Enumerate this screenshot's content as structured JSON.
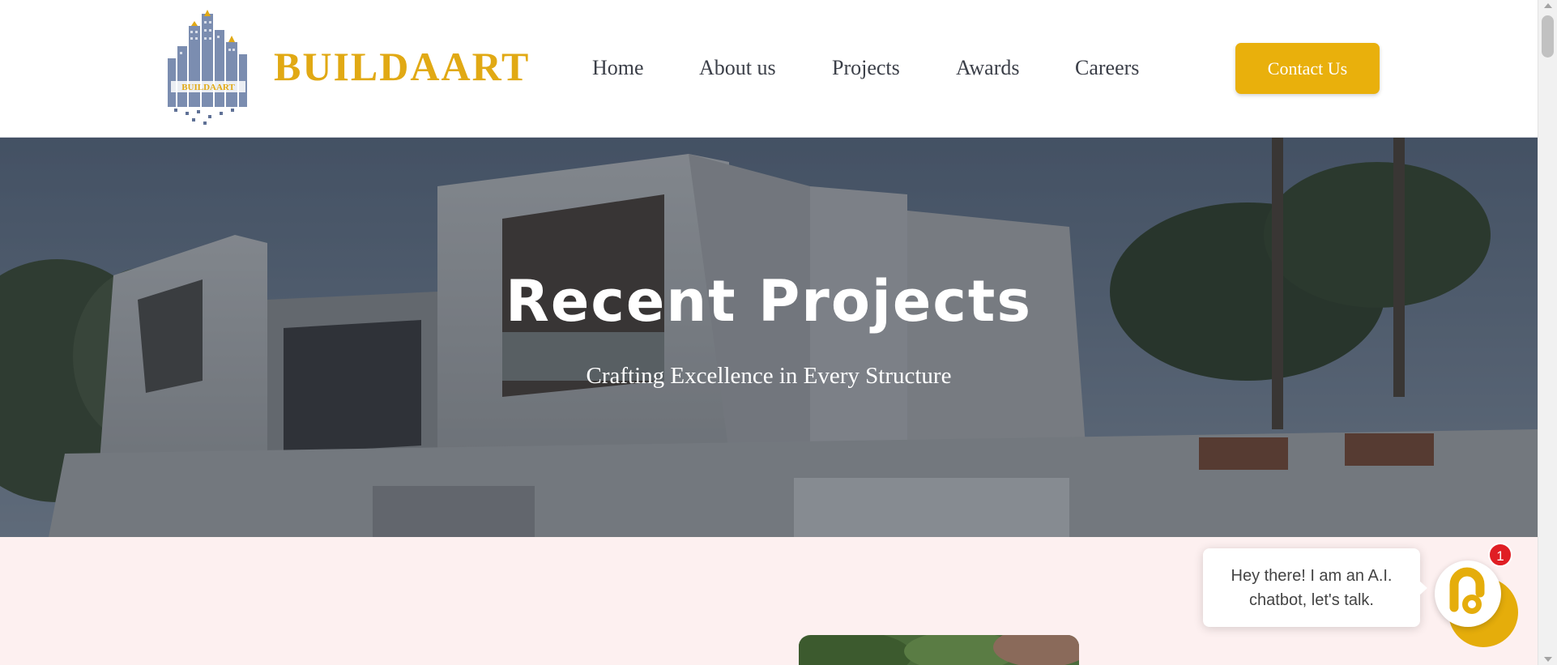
{
  "brand": {
    "name": "BUILDAART",
    "logo_text": "BUILDAART",
    "color": "#e1a914"
  },
  "nav": {
    "items": [
      {
        "label": "Home"
      },
      {
        "label": "About us"
      },
      {
        "label": "Projects"
      },
      {
        "label": "Awards"
      },
      {
        "label": "Careers"
      }
    ],
    "contact_label": "Contact Us",
    "contact_color": "#e9b00c"
  },
  "hero": {
    "title": "Recent Projects",
    "subtitle": "Crafting Excellence in Every Structure"
  },
  "chat": {
    "message": "Hey there! I am an A.I. chatbot, let's talk.",
    "badge_count": "1",
    "accent_color": "#e5ad0b",
    "badge_color": "#e01e24"
  },
  "colors": {
    "section_bg": "#fdf0f0",
    "nav_text": "#3b3f48"
  }
}
